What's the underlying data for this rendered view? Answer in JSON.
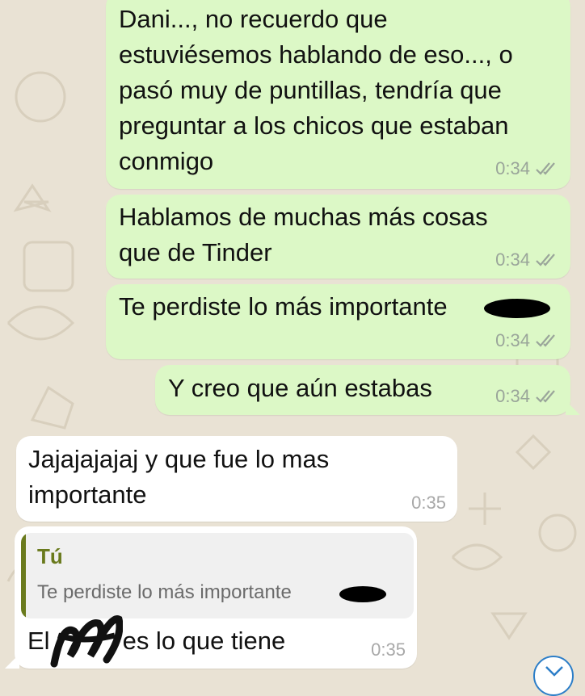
{
  "messages": [
    {
      "direction": "outgoing",
      "lines": [
        "Dani..., no recuerdo que",
        "estuviésemos hablando de eso..., o",
        "pasó muy de puntillas, tendría que",
        "preguntar a los chicos que estaban",
        "conmigo"
      ],
      "time": "0:34"
    },
    {
      "direction": "outgoing",
      "lines": [
        "Hablamos de muchas más cosas",
        "que de Tinder"
      ],
      "time": "0:34"
    },
    {
      "direction": "outgoing",
      "lines": [
        "Te perdiste lo más importante"
      ],
      "time": "0:34",
      "has_redaction": true
    },
    {
      "direction": "outgoing",
      "lines": [
        "Y creo que aún estabas"
      ],
      "time": "0:34"
    },
    {
      "direction": "incoming",
      "lines": [
        "Jajajajajaj y que fue lo mas",
        "importante"
      ],
      "time": "0:35"
    },
    {
      "direction": "incoming",
      "quote": {
        "author": "Tú",
        "text": "Te perdiste lo más importante"
      },
      "text_start": "El",
      "text_end": "es lo que tiene",
      "time": "0:35",
      "has_redaction": true
    }
  ],
  "colors": {
    "outgoing_bubble": "#dcf8c6",
    "incoming_bubble": "#ffffff",
    "background": "#e9e2d4",
    "quote_accent": "#6a7a1d"
  },
  "icons": {
    "read_receipt": "double-check-icon",
    "scroll_down": "chevron-down-icon"
  }
}
